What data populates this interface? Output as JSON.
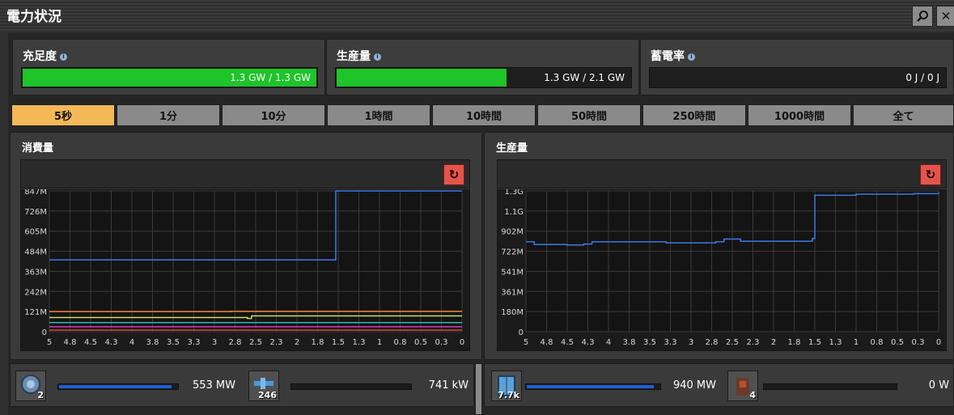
{
  "window": {
    "title": "電力状況"
  },
  "stats": [
    {
      "label": "充足度",
      "value": "1.3 GW / 1.3 GW",
      "fill": 1.0
    },
    {
      "label": "生産量",
      "value": "1.3 GW / 2.1 GW",
      "fill": 0.58
    },
    {
      "label": "蓄電率",
      "value": "0 J / 0 J",
      "fill": 0.0
    }
  ],
  "tabs": [
    "5秒",
    "1分",
    "10分",
    "1時間",
    "10時間",
    "50時間",
    "250時間",
    "1000時間",
    "全て"
  ],
  "active_tab": 0,
  "panels": {
    "consumption_title": "消費量",
    "production_title": "生産量"
  },
  "chart_data": [
    {
      "type": "line",
      "title": "消費量",
      "x_ticks": [
        "5",
        "4.8",
        "4.5",
        "4.3",
        "4",
        "3.8",
        "3.5",
        "3.3",
        "3",
        "2.8",
        "2.5",
        "2.3",
        "2",
        "1.8",
        "1.5",
        "1.3",
        "1",
        "0.8",
        "0.5",
        "0.3",
        "0"
      ],
      "y_ticks": [
        "0",
        "121M",
        "242M",
        "363M",
        "484M",
        "605M",
        "726M",
        "847M"
      ],
      "ylim": [
        0,
        847
      ],
      "xlim": [
        5,
        0
      ],
      "grid": true,
      "series": [
        {
          "color": "#3b7ae0",
          "x": [
            5,
            1.53,
            1.53,
            0
          ],
          "y": [
            432,
            432,
            847,
            847
          ]
        },
        {
          "color": "#f08c3a",
          "x": [
            5,
            2.8,
            2.8,
            0
          ],
          "y": [
            121,
            117,
            122,
            122
          ]
        },
        {
          "color": "#c8d870",
          "x": [
            5,
            2.6,
            2.55,
            0
          ],
          "y": [
            85,
            80,
            95,
            95
          ]
        },
        {
          "color": "#2fb8b0",
          "x": [
            5,
            0
          ],
          "y": [
            55,
            55
          ]
        },
        {
          "color": "#d040c0",
          "x": [
            5,
            0
          ],
          "y": [
            30,
            30
          ]
        },
        {
          "color": "#e04040",
          "x": [
            5,
            0
          ],
          "y": [
            10,
            10
          ]
        }
      ]
    },
    {
      "type": "line",
      "title": "生産量",
      "x_ticks": [
        "5",
        "4.8",
        "4.5",
        "4.3",
        "4",
        "3.8",
        "3.5",
        "3.3",
        "3",
        "2.8",
        "2.5",
        "2.3",
        "2",
        "1.8",
        "1.5",
        "1.3",
        "1",
        "0.8",
        "0.5",
        "0.3",
        "0"
      ],
      "y_ticks": [
        "0",
        "180M",
        "361M",
        "541M",
        "722M",
        "902M",
        "1.1G",
        "1.3G"
      ],
      "ylim": [
        0,
        1300
      ],
      "xlim": [
        5,
        0
      ],
      "grid": true,
      "series": [
        {
          "color": "#3b7ae0",
          "x": [
            5,
            4.9,
            4.5,
            4.3,
            4.2,
            3.5,
            3.3,
            2.8,
            2.7,
            2.6,
            2.4,
            1.6,
            1.53,
            1.5,
            1.0,
            0.3,
            0
          ],
          "y": [
            830,
            805,
            800,
            810,
            830,
            830,
            820,
            820,
            830,
            855,
            835,
            835,
            860,
            1260,
            1270,
            1275,
            1285
          ]
        }
      ]
    }
  ],
  "bottom_items": [
    {
      "icon": "accumulator-icon",
      "count": "2",
      "fill": 0.95,
      "value": "553 MW"
    },
    {
      "icon": "inserter-icon",
      "count": "246",
      "fill": 0.0,
      "value": "741 kW"
    },
    {
      "icon": "solar-panel-icon",
      "count": "7.7k",
      "fill": 0.96,
      "value": "940 MW"
    },
    {
      "icon": "steam-engine-icon",
      "count": "4",
      "fill": 0.0,
      "value": "0 W"
    }
  ]
}
